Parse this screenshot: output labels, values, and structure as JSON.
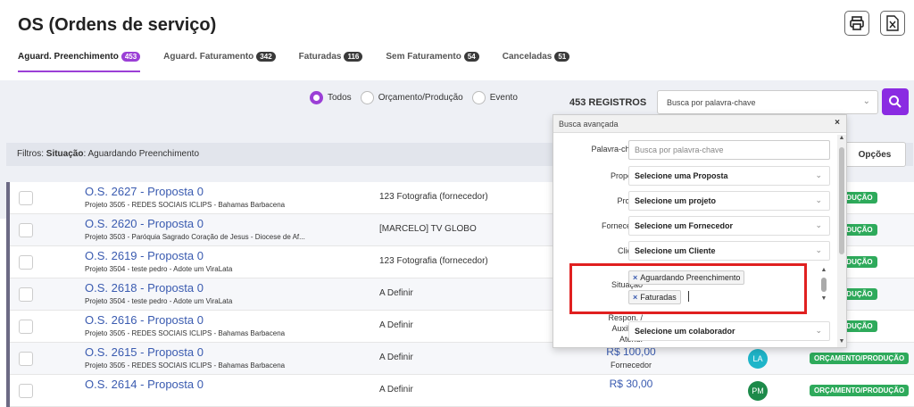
{
  "page_title": "OS (Ordens de serviço)",
  "tabs": [
    {
      "label": "Aguard. Preenchimento",
      "count": "453",
      "active": true
    },
    {
      "label": "Aguard. Faturamento",
      "count": "342",
      "active": false
    },
    {
      "label": "Faturadas",
      "count": "116",
      "active": false
    },
    {
      "label": "Sem Faturamento",
      "count": "54",
      "active": false
    },
    {
      "label": "Canceladas",
      "count": "51",
      "active": false
    }
  ],
  "header_buttons": {
    "print_icon": "printer-icon",
    "excel_icon": "excel-icon"
  },
  "radios": {
    "todos": "Todos",
    "orcamento": "Orçamento/Produção",
    "evento": "Evento",
    "selected": "Todos"
  },
  "record_count": "453 REGISTROS",
  "search": {
    "placeholder": "Busca por palavra-chave"
  },
  "filters": {
    "prefix": "Filtros: ",
    "key": "Situação",
    "value": ": Aguardando Preenchimento"
  },
  "options_label": "Opções",
  "rows": [
    {
      "os": "O.S. 2627 - Proposta 0",
      "project": "Projeto 3505 - REDES SOCIAIS ICLIPS - Bahamas Barbacena",
      "supplier": "123 Fotografia (fornecedor)",
      "status": "NTO/PRODUÇÃO"
    },
    {
      "os": "O.S. 2620 - Proposta 0",
      "project": "Projeto 3503 - Paróquia Sagrado Coração de Jesus - Diocese de Af...",
      "supplier": "[MARCELO] TV GLOBO",
      "status": "NTO/PRODUÇÃO"
    },
    {
      "os": "O.S. 2619 - Proposta 0",
      "project": "Projeto 3504 - teste pedro - Adote um ViraLata",
      "supplier": "123 Fotografia (fornecedor)",
      "status": "NTO/PRODUÇÃO"
    },
    {
      "os": "O.S. 2618 - Proposta 0",
      "project": "Projeto 3504 - teste pedro - Adote um ViraLata",
      "supplier": "A Definir",
      "status": "NTO/PRODUÇÃO"
    },
    {
      "os": "O.S. 2616 - Proposta 0",
      "project": "Projeto 3505 - REDES SOCIAIS ICLIPS - Bahamas Barbacena",
      "supplier": "A Definir",
      "status": "NTO/PRODUÇÃO"
    },
    {
      "os": "O.S. 2615 - Proposta 0",
      "project": "Projeto 3505 - REDES SOCIAIS ICLIPS - Bahamas Barbacena",
      "supplier": "A Definir",
      "value": "R$ 100,00",
      "value_sub": "Fornecedor",
      "avatar": "LA",
      "avatar_color": "#1fb5c9",
      "status": "ORÇAMENTO/PRODUÇÃO"
    },
    {
      "os": "O.S. 2614 - Proposta 0",
      "project": "",
      "supplier": "A Definir",
      "value": "R$ 30,00",
      "value_sub": "",
      "avatar": "PM",
      "avatar_color": "#1d8a4a",
      "status": "ORÇAMENTO/PRODUÇÃO"
    }
  ],
  "advanced_search": {
    "title": "Busca avançada",
    "close": "×",
    "keyword_label": "Palavra-chave",
    "keyword_placeholder": "Busca por palavra-chave",
    "proposta_label": "Proposta",
    "proposta_value": "Selecione uma Proposta",
    "projeto_label": "Projeto",
    "projeto_value": "Selecione um projeto",
    "fornecedor_label": "Fornecedor",
    "fornecedor_value": "Selecione um Fornecedor",
    "cliente_label": "Cliente",
    "cliente_value": "Selecione um Cliente",
    "situacao_label": "Situação",
    "situacao_tags": [
      "Aguardando Preenchimento",
      "Faturadas"
    ],
    "respon_label_1": "Respon. /",
    "respon_label_2": "Auxiliar /",
    "respon_label_3": "Atend.",
    "respon_value": "Selecione um colaborador"
  },
  "colors": {
    "accent": "#9b3fd6",
    "search_button": "#8a2be2",
    "link": "#3a5bb0",
    "status_green": "#2eaa5b",
    "highlight": "#e02020"
  }
}
